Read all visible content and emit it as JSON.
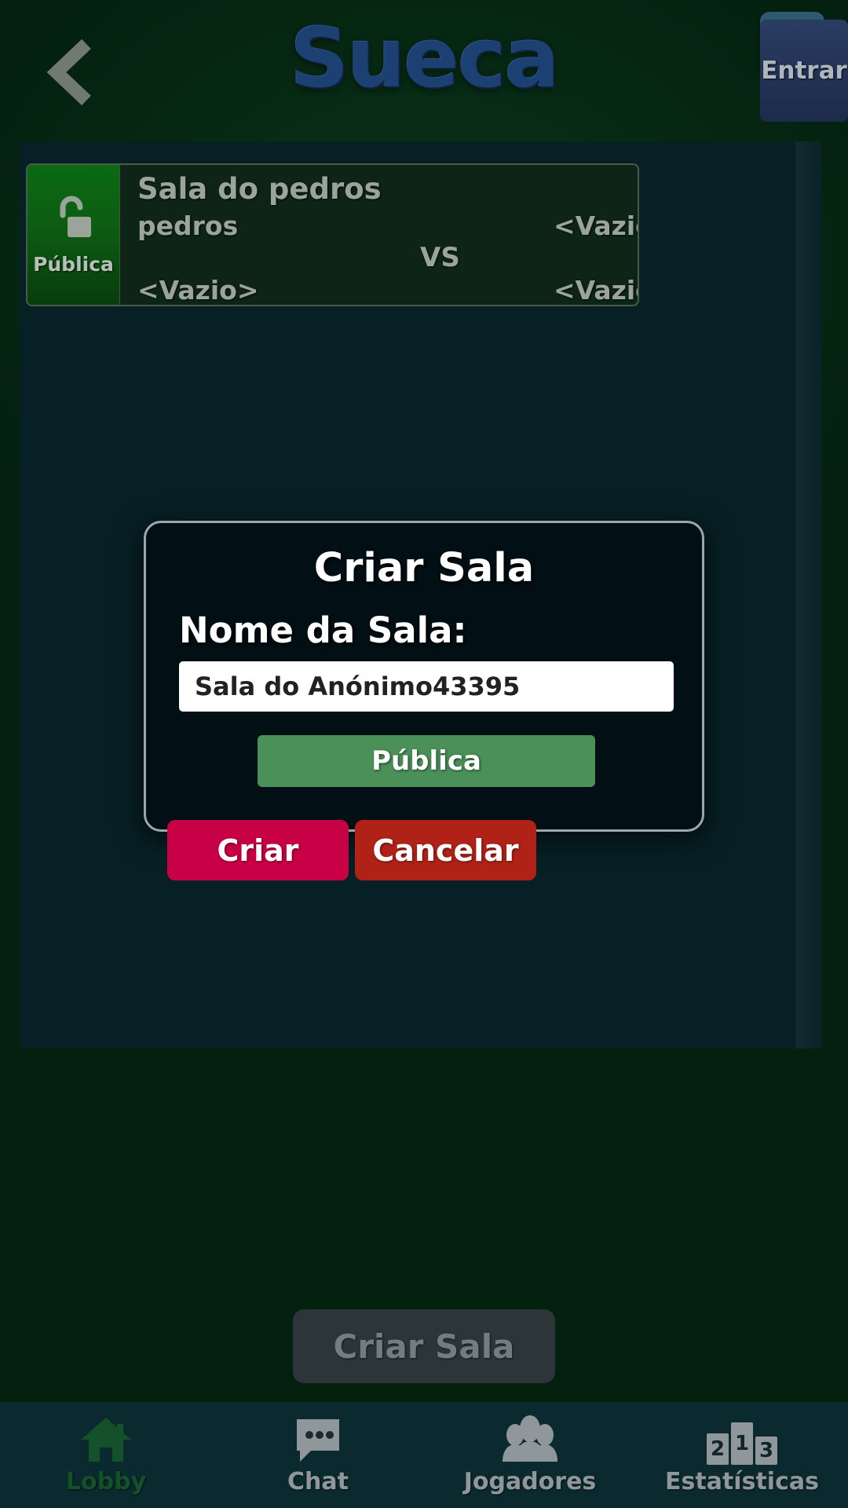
{
  "header": {
    "back_icon": "chevron-left-icon",
    "title": "Sueca",
    "invite_icon": "open-envelope-upload-icon",
    "title_color": "#1c4071",
    "invite_button_color": "#2d596e"
  },
  "room_list": [
    {
      "privacy_label": "Pública",
      "privacy_icon": "unlocked-padlock-icon",
      "privacy_color": "#0a6a12",
      "title": "Sala do pedros",
      "team_a_player_1": "pedros",
      "team_a_player_2": "<Vazio>",
      "team_b_player_1": "<Vazio>",
      "team_b_player_2": "<Vazio>",
      "versus_label": "VS",
      "enter_label": "Entrar"
    }
  ],
  "create_room_button": {
    "label": "Criar Sala"
  },
  "dialog": {
    "title": "Criar Sala",
    "room_name_label": "Nome da Sala:",
    "room_name_value": "Sala do Anónimo43395",
    "room_name_placeholder": "Nome da Sala",
    "privacy_toggle_label": "Pública",
    "privacy_toggle_color": "#4a9058",
    "confirm_label": "Criar",
    "confirm_color": "#c80045",
    "cancel_label": "Cancelar",
    "cancel_color": "#b02217"
  },
  "bottom_nav": {
    "items": [
      {
        "label": "Lobby",
        "icon": "house-icon",
        "active": true
      },
      {
        "label": "Chat",
        "icon": "chat-bubble-icon",
        "active": false
      },
      {
        "label": "Jogadores",
        "icon": "people-icon",
        "active": false
      },
      {
        "label": "Estatísticas",
        "icon": "podium-icon",
        "active": false
      }
    ],
    "podium_labels": [
      "2",
      "1",
      "3"
    ],
    "active_color": "#14502a",
    "inactive_color": "#8f979a",
    "background_color": "#0b2a30"
  },
  "theme": {
    "page_background": "#04210f",
    "panel_background": "#072026",
    "dialog_background": "#020f14"
  }
}
